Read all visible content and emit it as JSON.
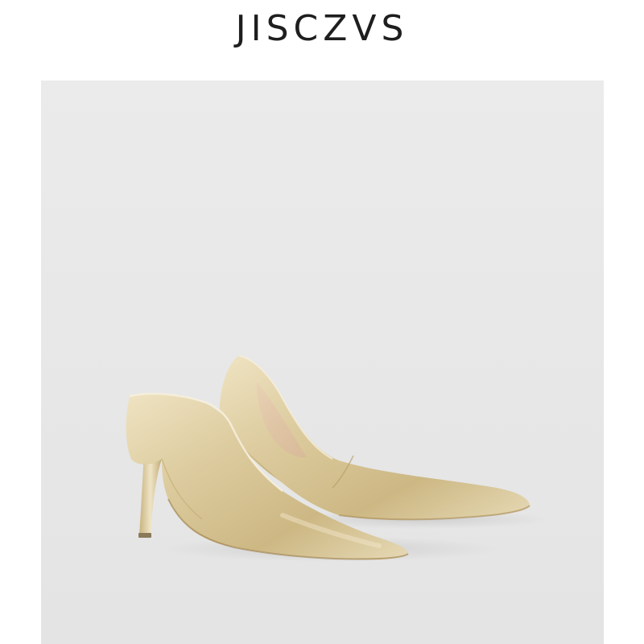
{
  "brand": {
    "name": "JISCZVS"
  },
  "product_image": {
    "subject": "gold-pumps-pair",
    "background_color": "#e8e8e8",
    "shoe_color": "#d9c79a"
  }
}
